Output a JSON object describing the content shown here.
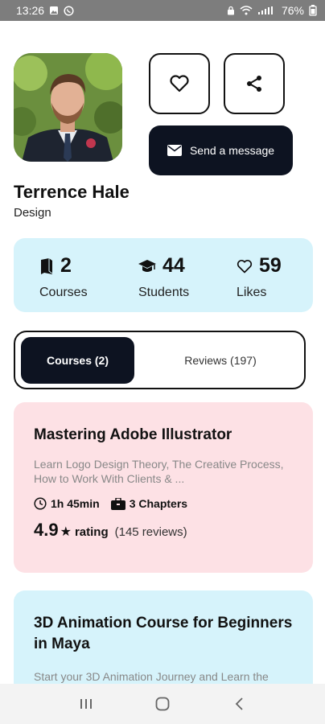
{
  "status_bar": {
    "time": "13:26",
    "battery": "76%"
  },
  "profile": {
    "name": "Terrence Hale",
    "role": "Design",
    "message_button": "Send a message"
  },
  "stats": [
    {
      "icon": "book-icon",
      "value": "2",
      "label": "Courses"
    },
    {
      "icon": "graduation-cap-icon",
      "value": "44",
      "label": "Students"
    },
    {
      "icon": "heart-outline-icon",
      "value": "59",
      "label": "Likes"
    }
  ],
  "tabs": [
    {
      "label": "Courses (2)",
      "active": true
    },
    {
      "label": "Reviews (197)",
      "active": false
    }
  ],
  "courses": [
    {
      "title": "Mastering Adobe Illustrator",
      "description": "Learn Logo Design Theory, The Creative Process, How to Work With Clients & ...",
      "duration": "1h 45min",
      "chapters": "3 Chapters",
      "rating": "4.9",
      "rating_label": "rating",
      "reviews": "(145 reviews)",
      "color": "#fde1e5"
    },
    {
      "title": "3D Animation Course for Beginners in Maya",
      "description": "Start your 3D Animation Journey and Learn the",
      "color": "#d6f3fb"
    }
  ],
  "colors": {
    "dark": "#0d1321",
    "light_blue": "#d6f3fb",
    "light_pink": "#fde1e5"
  }
}
